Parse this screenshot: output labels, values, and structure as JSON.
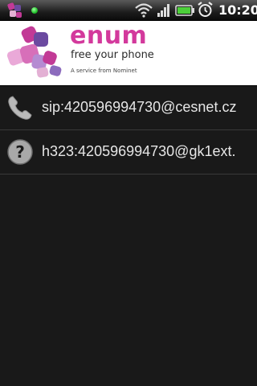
{
  "status_bar": {
    "time": "10:20",
    "icons": [
      "enum-app-icon",
      "green-dot-icon",
      "wifi-icon",
      "signal-icon",
      "battery-icon",
      "alarm-clock-icon"
    ]
  },
  "banner": {
    "brand": "enum",
    "tagline": "free your phone",
    "service_note": "A service from Nominet",
    "colors": {
      "brand_pink": "#d3399c",
      "purple": "#5a3c8e"
    }
  },
  "entries": [
    {
      "icon": "phone-handset-icon",
      "text": "sip:420596994730@cesnet.cz"
    },
    {
      "icon": "question-mark-icon",
      "text": "h323:420596994730@gk1ext."
    }
  ]
}
